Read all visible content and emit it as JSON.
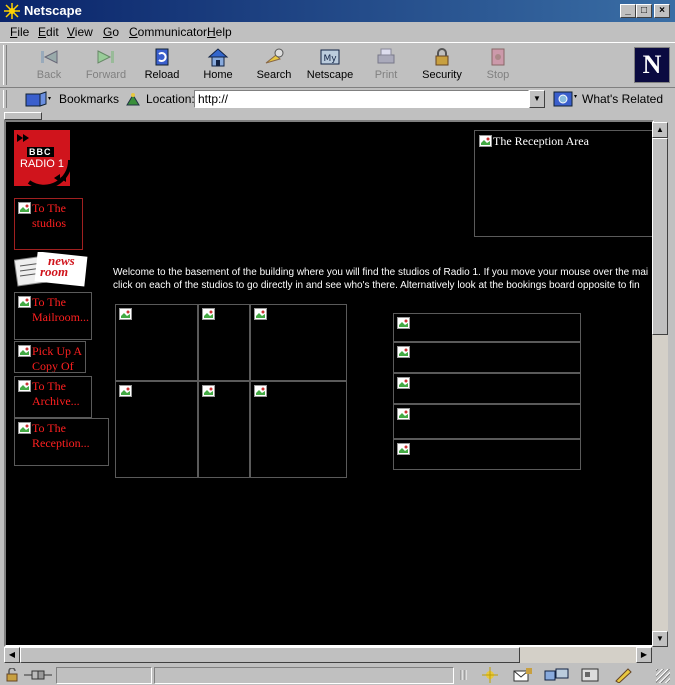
{
  "window": {
    "title": "Netscape"
  },
  "menu": [
    "File",
    "Edit",
    "View",
    "Go",
    "Communicator",
    "Help"
  ],
  "toolbar": {
    "buttons": [
      {
        "label": "Back",
        "icon": "back-arrow-icon",
        "enabled": false
      },
      {
        "label": "Forward",
        "icon": "forward-arrow-icon",
        "enabled": false
      },
      {
        "label": "Reload",
        "icon": "reload-icon",
        "enabled": true
      },
      {
        "label": "Home",
        "icon": "home-icon",
        "enabled": true
      },
      {
        "label": "Search",
        "icon": "search-icon",
        "enabled": true
      },
      {
        "label": "Netscape",
        "icon": "my-netscape-icon",
        "enabled": true
      },
      {
        "label": "Print",
        "icon": "printer-icon",
        "enabled": false
      },
      {
        "label": "Security",
        "icon": "padlock-icon",
        "enabled": true
      },
      {
        "label": "Stop",
        "icon": "stop-icon",
        "enabled": false
      }
    ],
    "logo": "N"
  },
  "location_bar": {
    "bookmarks_label": "Bookmarks",
    "location_label": "Location:",
    "url": "http://",
    "whats_related_label": "What's Related"
  },
  "page": {
    "logo_text": {
      "line1": "BBC",
      "line2": "RADIO 1"
    },
    "newsroom_text": {
      "line1": "news",
      "line2": "room"
    },
    "nav": [
      {
        "line1": "To The",
        "line2": "studios"
      },
      {
        "line1": "To The",
        "line2": "Mailroom..."
      },
      {
        "line1": "Pick Up A",
        "line2": "Copy Of"
      },
      {
        "line1": "To The",
        "line2": "Archive..."
      },
      {
        "line1": "To The",
        "line2": "Reception..."
      }
    ],
    "reception_label": "The Reception Area",
    "welcome_line1": "Welcome to the basement of the building where you will find the studios of Radio 1. If you move your mouse over the mai",
    "welcome_line2": "click on each of the studios to go directly in and see who's there. Alternatively look at the bookings board opposite to fin"
  },
  "colors": {
    "page_background": "#000000",
    "nav_link": "#ff2020",
    "radio1_red": "#d0141c",
    "titlebar": "#0a246a"
  }
}
